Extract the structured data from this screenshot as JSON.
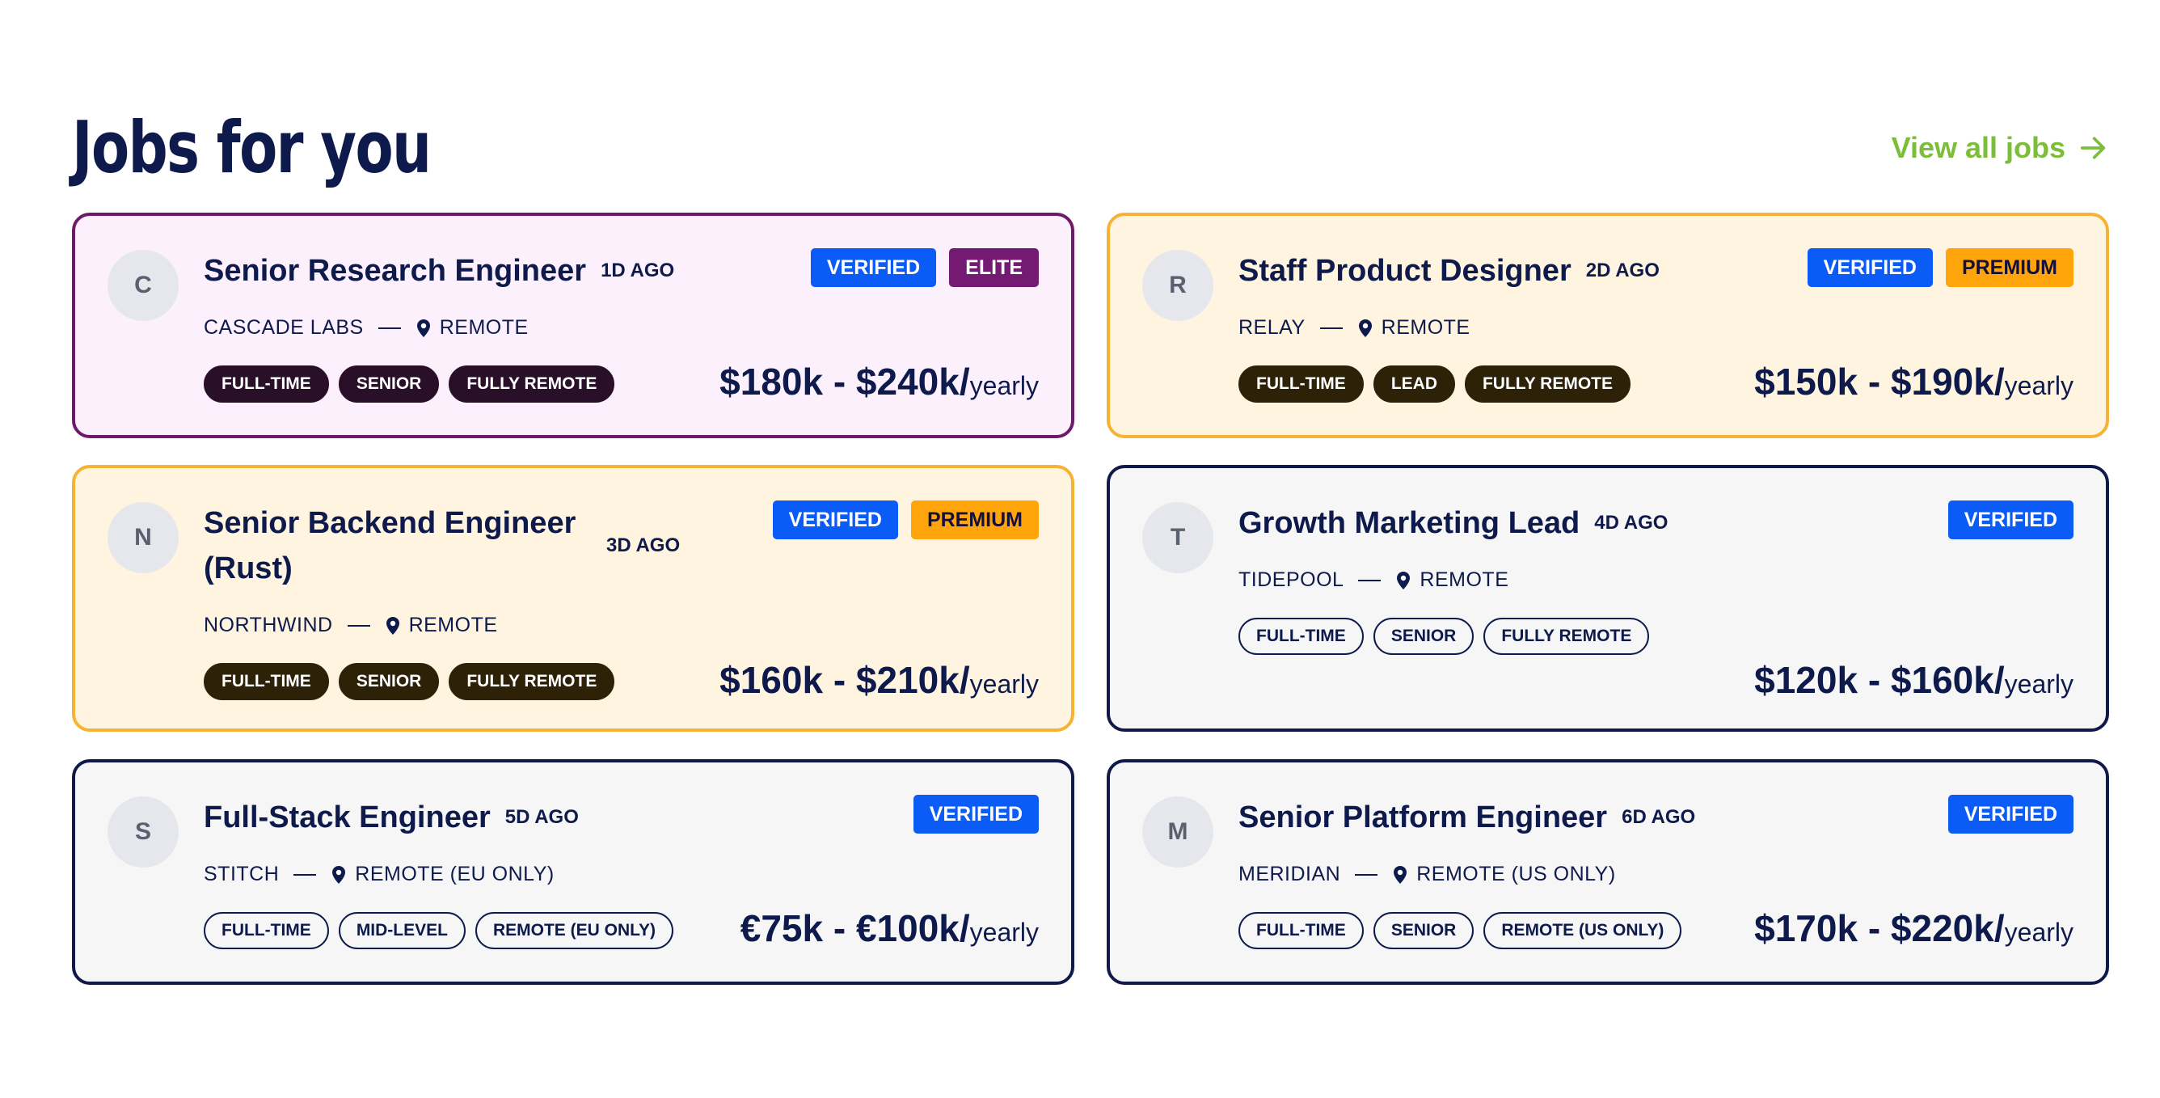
{
  "page": {
    "title": "Jobs for you",
    "view_all": {
      "label": "View all jobs",
      "icon": "arrow-right-icon"
    }
  },
  "colors": {
    "accent_green": "#7cbd3a",
    "verified_badge": "#0b5cf6",
    "elite_badge": "#741a72",
    "premium_badge": "#ffa40b",
    "navy_text": "#0d1a4b"
  },
  "jobs": [
    {
      "tier": "elite",
      "avatar_letter": "C",
      "title": "Senior Research Engineer",
      "posted": "1D AGO",
      "badges": [
        "VERIFIED",
        "ELITE"
      ],
      "company": "CASCADE LABS",
      "location": "REMOTE",
      "tags": [
        "FULL-TIME",
        "SENIOR",
        "FULLY REMOTE"
      ],
      "salary": "$180k - $240k/",
      "period": "yearly"
    },
    {
      "tier": "premium",
      "avatar_letter": "R",
      "title": "Staff Product Designer",
      "posted": "2D AGO",
      "badges": [
        "VERIFIED",
        "PREMIUM"
      ],
      "company": "RELAY",
      "location": "REMOTE",
      "tags": [
        "FULL-TIME",
        "LEAD",
        "FULLY REMOTE"
      ],
      "salary": "$150k - $190k/",
      "period": "yearly"
    },
    {
      "tier": "premium",
      "avatar_letter": "N",
      "title": "Senior Backend Engineer (Rust)",
      "posted": "3D AGO",
      "badges": [
        "VERIFIED",
        "PREMIUM"
      ],
      "company": "NORTHWIND",
      "location": "REMOTE",
      "tags": [
        "FULL-TIME",
        "SENIOR",
        "FULLY REMOTE"
      ],
      "salary": "$160k - $210k/",
      "period": "yearly"
    },
    {
      "tier": "standard",
      "avatar_letter": "T",
      "title": "Growth Marketing Lead",
      "posted": "4D AGO",
      "badges": [
        "VERIFIED"
      ],
      "company": "TIDEPOOL",
      "location": "REMOTE",
      "tags": [
        "FULL-TIME",
        "SENIOR",
        "FULLY REMOTE"
      ],
      "salary": "$120k - $160k/",
      "period": "yearly"
    },
    {
      "tier": "standard",
      "avatar_letter": "S",
      "title": "Full-Stack Engineer",
      "posted": "5D AGO",
      "badges": [
        "VERIFIED"
      ],
      "company": "STITCH",
      "location": "REMOTE (EU ONLY)",
      "tags": [
        "FULL-TIME",
        "MID-LEVEL",
        "REMOTE (EU ONLY)"
      ],
      "salary": "€75k - €100k/",
      "period": "yearly"
    },
    {
      "tier": "standard",
      "avatar_letter": "M",
      "title": "Senior Platform Engineer",
      "posted": "6D AGO",
      "badges": [
        "VERIFIED"
      ],
      "company": "MERIDIAN",
      "location": "REMOTE (US ONLY)",
      "tags": [
        "FULL-TIME",
        "SENIOR",
        "REMOTE (US ONLY)"
      ],
      "salary": "$170k - $220k/",
      "period": "yearly"
    }
  ]
}
